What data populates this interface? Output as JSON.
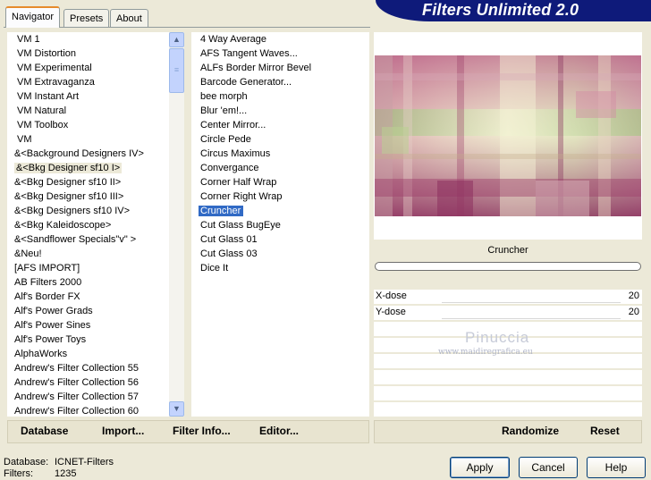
{
  "title": "Filters Unlimited 2.0",
  "tabs": [
    "Navigator",
    "Presets",
    "About"
  ],
  "categories": [
    "VM 1",
    "VM Distortion",
    "VM Experimental",
    "VM Extravaganza",
    "VM Instant Art",
    "VM Natural",
    "VM Toolbox",
    "VM",
    "&<Background Designers IV>",
    "&<Bkg Designer sf10 I>",
    "&<Bkg Designer sf10 II>",
    "&<Bkg Designer sf10 III>",
    "&<Bkg Designers sf10 IV>",
    "&<Bkg Kaleidoscope>",
    "&<Sandflower Specials\"v\" >",
    "&Neu!",
    "[AFS IMPORT]",
    "AB Filters 2000",
    "Alf's Border FX",
    "Alf's Power Grads",
    "Alf's Power Sines",
    "Alf's Power Toys",
    "AlphaWorks",
    "Andrew's Filter Collection 55",
    "Andrew's Filter Collection 56",
    "Andrew's Filter Collection 57",
    "Andrew's Filter Collection 60"
  ],
  "selected_category": "&<Bkg Designer sf10 I>",
  "filters": [
    "4 Way Average",
    "AFS Tangent Waves...",
    "ALFs Border Mirror Bevel",
    "Barcode Generator...",
    "bee morph",
    "Blur 'em!...",
    "Center Mirror...",
    "Circle Pede",
    "Circus Maximus",
    "Convergance",
    "Corner Half Wrap",
    "Corner Right Wrap",
    "Cruncher",
    "Cut Glass  BugEye",
    "Cut Glass 01",
    "Cut Glass 03",
    "Dice It"
  ],
  "selected_filter": "Cruncher",
  "preview": {
    "filter_name": "Cruncher"
  },
  "params": [
    {
      "label": "X-dose",
      "value": "20"
    },
    {
      "label": "Y-dose",
      "value": "20"
    }
  ],
  "watermark": {
    "name": "Pinuccia",
    "url": "www.maidiregrafica.eu"
  },
  "left_buttons": {
    "database": "Database",
    "import": "Import...",
    "filter_info": "Filter Info...",
    "editor": "Editor..."
  },
  "right_buttons": {
    "randomize": "Randomize",
    "reset": "Reset"
  },
  "status": {
    "database_label": "Database:",
    "database_value": "ICNET-Filters",
    "filters_label": "Filters:",
    "filters_value": "1235"
  },
  "dialog_buttons": {
    "apply": "Apply",
    "cancel": "Cancel",
    "help": "Help"
  },
  "colors": {
    "banner": "#0e1a7a",
    "selection": "#316ac5",
    "tab_highlight": "#e68b2c"
  },
  "scroll_icons": [
    "scroll-up-arrow",
    "scroll-down-arrow"
  ]
}
